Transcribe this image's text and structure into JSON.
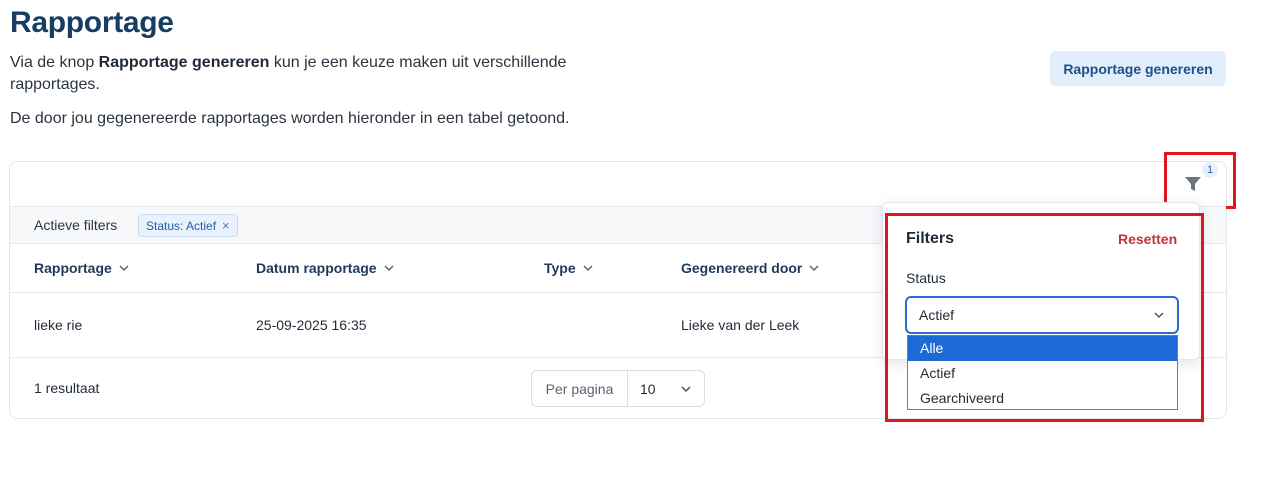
{
  "page": {
    "title": "Rapportage",
    "intro_prefix": "Via de knop ",
    "intro_bold": "Rapportage genereren",
    "intro_suffix": " kun je een keuze maken uit verschillende rapportages.",
    "intro_line2": "De door jou gegenereerde rapportages worden hieronder in een tabel getoond."
  },
  "toolbar": {
    "generate_label": "Rapportage genereren",
    "filter_icon": "funnel-icon",
    "filter_count": "1"
  },
  "active_filters": {
    "label": "Actieve filters",
    "chips": [
      {
        "label": "Status: Actief",
        "remove": "×"
      }
    ]
  },
  "table": {
    "columns": [
      {
        "label": "Rapportage"
      },
      {
        "label": "Datum rapportage"
      },
      {
        "label": "Type"
      },
      {
        "label": "Gegenereerd door"
      }
    ],
    "rows": [
      {
        "rapportage": "lieke rie",
        "datum": "25-09-2025 16:35",
        "type": "",
        "door": "Lieke van der Leek"
      }
    ]
  },
  "footer": {
    "results": "1 resultaat",
    "per_page_label": "Per pagina",
    "per_page_value": "10"
  },
  "filter_panel": {
    "title": "Filters",
    "reset_label": "Resetten",
    "status_label": "Status",
    "status_value": "Actief",
    "options": [
      "Alle",
      "Actief",
      "Gearchiveerd"
    ],
    "highlighted_option": "Alle"
  },
  "colors": {
    "title": "#173d62",
    "primary_button_bg": "#e2eefb",
    "reset": "#c0343a",
    "highlight_box": "#e0161e",
    "option_selected": "#1b6ad6"
  }
}
